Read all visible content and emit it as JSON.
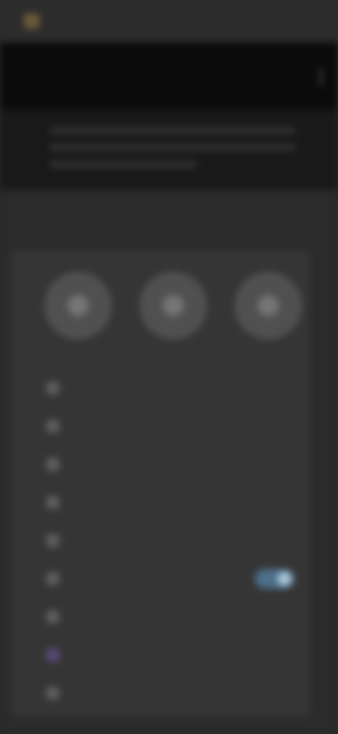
{
  "top_bar": {
    "logo_text": "",
    "right_text": ""
  },
  "header": {
    "title": ""
  },
  "intro": {
    "lines": [
      "",
      "",
      ""
    ]
  },
  "section": {
    "title": "",
    "subtitle": ""
  },
  "circles": [
    {
      "icon": "circle-icon",
      "label": ""
    },
    {
      "icon": "circle-icon",
      "label": ""
    },
    {
      "icon": "circle-icon",
      "label": ""
    }
  ],
  "menu": [
    {
      "icon": "menu-icon",
      "label": ""
    },
    {
      "icon": "menu-icon",
      "label": ""
    },
    {
      "icon": "menu-icon",
      "label": ""
    },
    {
      "icon": "menu-icon",
      "label": ""
    },
    {
      "icon": "menu-icon",
      "label": ""
    },
    {
      "icon": "menu-icon",
      "label": "",
      "toggle": true
    },
    {
      "icon": "menu-icon",
      "label": ""
    },
    {
      "icon": "purple-icon",
      "label": ""
    },
    {
      "icon": "menu-icon",
      "label": ""
    }
  ],
  "colors": {
    "background": "#2b2b2b",
    "header": "#0b0b0b",
    "card": "#353535",
    "toggle_on": "#4c6f8a",
    "accent_purple": "#584a78"
  }
}
